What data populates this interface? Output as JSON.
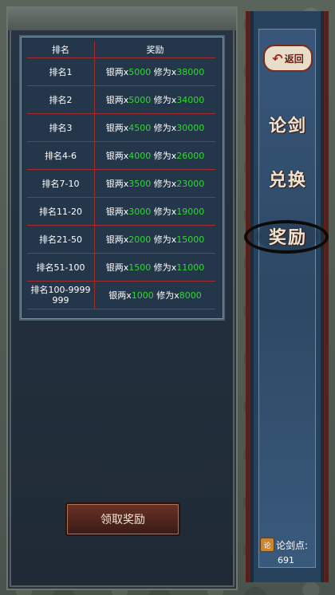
{
  "table": {
    "headers": {
      "rank": "排名",
      "reward": "奖励"
    },
    "rows": [
      {
        "rank": "排名1",
        "silver_label": "银两x",
        "silver": "5000",
        "xiuwei_label": " 修为x",
        "xiuwei": "38000"
      },
      {
        "rank": "排名2",
        "silver_label": "银两x",
        "silver": "5000",
        "xiuwei_label": " 修为x",
        "xiuwei": "34000"
      },
      {
        "rank": "排名3",
        "silver_label": "银两x",
        "silver": "4500",
        "xiuwei_label": " 修为x",
        "xiuwei": "30000"
      },
      {
        "rank": "排名4-6",
        "silver_label": "银两x",
        "silver": "4000",
        "xiuwei_label": " 修为x",
        "xiuwei": "26000"
      },
      {
        "rank": "排名7-10",
        "silver_label": "银两x",
        "silver": "3500",
        "xiuwei_label": " 修为x",
        "xiuwei": "23000"
      },
      {
        "rank": "排名11-20",
        "silver_label": "银两x",
        "silver": "3000",
        "xiuwei_label": " 修为x",
        "xiuwei": "19000"
      },
      {
        "rank": "排名21-50",
        "silver_label": "银两x",
        "silver": "2000",
        "xiuwei_label": " 修为x",
        "xiuwei": "15000"
      },
      {
        "rank": "排名51-100",
        "silver_label": "银两x",
        "silver": "1500",
        "xiuwei_label": " 修为x",
        "xiuwei": "11000"
      },
      {
        "rank": "排名100-9999999",
        "silver_label": "银两x",
        "silver": "1000",
        "xiuwei_label": " 修为x",
        "xiuwei": "8000"
      }
    ]
  },
  "claim_button": {
    "label": "领取奖励"
  },
  "nav": {
    "back_label": "返回",
    "items": [
      {
        "label": "论剑"
      },
      {
        "label": "兑换"
      },
      {
        "label": "奖励"
      }
    ]
  },
  "points": {
    "label": "论剑点:",
    "value": "691",
    "icon_text": "论"
  },
  "colors": {
    "accent_green": "#2edc2e",
    "row_divider": "#a32d2d"
  }
}
